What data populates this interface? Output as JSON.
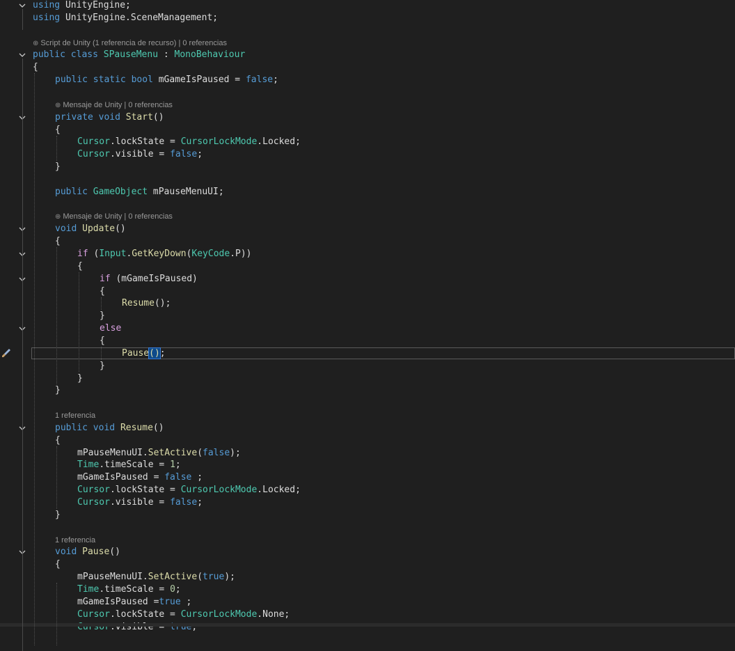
{
  "editor": {
    "language": "C#",
    "colors": {
      "background": "#1f1f1f",
      "keyword": "#569cd6",
      "control_keyword": "#d8a0df",
      "type": "#4ec9b0",
      "method": "#dcdcaa",
      "text": "#dcdcdc",
      "number": "#b5cea8",
      "codelens": "#9a9a9a"
    },
    "lines": [
      {
        "indent": 0,
        "fold": "open",
        "tokens": [
          [
            "kw",
            "using"
          ],
          [
            "plain",
            " UnityEngine;"
          ]
        ]
      },
      {
        "indent": 0,
        "tokens": [
          [
            "kw",
            "using"
          ],
          [
            "plain",
            " UnityEngine.SceneManagement;"
          ]
        ]
      },
      {
        "indent": 0,
        "tokens": []
      },
      {
        "lens": "Script de Unity (1 referencia de recurso) | 0 referencias",
        "lens_icon": "unity-icon",
        "indent": 0
      },
      {
        "indent": 0,
        "fold": "open",
        "tokens": [
          [
            "kw",
            "public"
          ],
          [
            "plain",
            " "
          ],
          [
            "kw",
            "class"
          ],
          [
            "plain",
            " "
          ],
          [
            "type",
            "SPauseMenu"
          ],
          [
            "plain",
            " : "
          ],
          [
            "type",
            "MonoBehaviour"
          ]
        ]
      },
      {
        "indent": 0,
        "tokens": [
          [
            "plain",
            "{"
          ]
        ]
      },
      {
        "indent": 1,
        "tokens": [
          [
            "kw",
            "public"
          ],
          [
            "plain",
            " "
          ],
          [
            "kw",
            "static"
          ],
          [
            "plain",
            " "
          ],
          [
            "kw",
            "bool"
          ],
          [
            "plain",
            " mGameIsPaused = "
          ],
          [
            "kw",
            "false"
          ],
          [
            "plain",
            ";"
          ]
        ]
      },
      {
        "indent": 0,
        "tokens": []
      },
      {
        "lens": "Mensaje de Unity | 0 referencias",
        "lens_icon": "unity-icon",
        "indent": 1
      },
      {
        "indent": 1,
        "fold": "open",
        "tokens": [
          [
            "kw",
            "private"
          ],
          [
            "plain",
            " "
          ],
          [
            "kw",
            "void"
          ],
          [
            "plain",
            " "
          ],
          [
            "fn",
            "Start"
          ],
          [
            "plain",
            "()"
          ]
        ]
      },
      {
        "indent": 1,
        "tokens": [
          [
            "plain",
            "{"
          ]
        ]
      },
      {
        "indent": 2,
        "tokens": [
          [
            "type",
            "Cursor"
          ],
          [
            "plain",
            ".lockState = "
          ],
          [
            "type",
            "CursorLockMode"
          ],
          [
            "plain",
            ".Locked;"
          ]
        ]
      },
      {
        "indent": 2,
        "tokens": [
          [
            "type",
            "Cursor"
          ],
          [
            "plain",
            ".visible = "
          ],
          [
            "kw",
            "false"
          ],
          [
            "plain",
            ";"
          ]
        ]
      },
      {
        "indent": 1,
        "tokens": [
          [
            "plain",
            "}"
          ]
        ]
      },
      {
        "indent": 0,
        "tokens": []
      },
      {
        "indent": 1,
        "tokens": [
          [
            "kw",
            "public"
          ],
          [
            "plain",
            " "
          ],
          [
            "type",
            "GameObject"
          ],
          [
            "plain",
            " mPauseMenuUI;"
          ]
        ]
      },
      {
        "indent": 0,
        "tokens": []
      },
      {
        "lens": "Mensaje de Unity | 0 referencias",
        "lens_icon": "unity-icon",
        "indent": 1
      },
      {
        "indent": 1,
        "fold": "open",
        "tokens": [
          [
            "kw",
            "void"
          ],
          [
            "plain",
            " "
          ],
          [
            "fn",
            "Update"
          ],
          [
            "plain",
            "()"
          ]
        ]
      },
      {
        "indent": 1,
        "tokens": [
          [
            "plain",
            "{"
          ]
        ]
      },
      {
        "indent": 2,
        "fold": "open",
        "tokens": [
          [
            "kw2",
            "if"
          ],
          [
            "plain",
            " ("
          ],
          [
            "type",
            "Input"
          ],
          [
            "plain",
            "."
          ],
          [
            "fn",
            "GetKeyDown"
          ],
          [
            "plain",
            "("
          ],
          [
            "type",
            "KeyCode"
          ],
          [
            "plain",
            ".P))"
          ]
        ]
      },
      {
        "indent": 2,
        "tokens": [
          [
            "plain",
            "{"
          ]
        ]
      },
      {
        "indent": 3,
        "fold": "open",
        "tokens": [
          [
            "kw2",
            "if"
          ],
          [
            "plain",
            " (mGameIsPaused)"
          ]
        ]
      },
      {
        "indent": 3,
        "tokens": [
          [
            "plain",
            "{"
          ]
        ]
      },
      {
        "indent": 4,
        "tokens": [
          [
            "fn",
            "Resume"
          ],
          [
            "plain",
            "();"
          ]
        ]
      },
      {
        "indent": 3,
        "tokens": [
          [
            "plain",
            "}"
          ]
        ]
      },
      {
        "indent": 3,
        "fold": "open",
        "tokens": [
          [
            "kw2",
            "else"
          ]
        ]
      },
      {
        "indent": 3,
        "tokens": [
          [
            "plain",
            "{"
          ]
        ]
      },
      {
        "indent": 4,
        "current": true,
        "tokens": [
          [
            "fn",
            "Pause"
          ],
          [
            "brk",
            "()"
          ],
          [
            "plain",
            ";"
          ]
        ]
      },
      {
        "indent": 3,
        "tokens": [
          [
            "plain",
            "}"
          ]
        ]
      },
      {
        "indent": 2,
        "tokens": [
          [
            "plain",
            "}"
          ]
        ]
      },
      {
        "indent": 1,
        "tokens": [
          [
            "plain",
            "}"
          ]
        ]
      },
      {
        "indent": 0,
        "tokens": []
      },
      {
        "lens": "1 referencia",
        "indent": 1
      },
      {
        "indent": 1,
        "fold": "open",
        "tokens": [
          [
            "kw",
            "public"
          ],
          [
            "plain",
            " "
          ],
          [
            "kw",
            "void"
          ],
          [
            "plain",
            " "
          ],
          [
            "fn",
            "Resume"
          ],
          [
            "plain",
            "()"
          ]
        ]
      },
      {
        "indent": 1,
        "tokens": [
          [
            "plain",
            "{"
          ]
        ]
      },
      {
        "indent": 2,
        "tokens": [
          [
            "plain",
            "mPauseMenuUI."
          ],
          [
            "fn",
            "SetActive"
          ],
          [
            "plain",
            "("
          ],
          [
            "kw",
            "false"
          ],
          [
            "plain",
            ");"
          ]
        ]
      },
      {
        "indent": 2,
        "tokens": [
          [
            "type",
            "Time"
          ],
          [
            "plain",
            ".timeScale = "
          ],
          [
            "num",
            "1"
          ],
          [
            "plain",
            ";"
          ]
        ]
      },
      {
        "indent": 2,
        "tokens": [
          [
            "plain",
            "mGameIsPaused = "
          ],
          [
            "kw",
            "false"
          ],
          [
            "plain",
            " ;"
          ]
        ]
      },
      {
        "indent": 2,
        "tokens": [
          [
            "type",
            "Cursor"
          ],
          [
            "plain",
            ".lockState = "
          ],
          [
            "type",
            "CursorLockMode"
          ],
          [
            "plain",
            ".Locked;"
          ]
        ]
      },
      {
        "indent": 2,
        "tokens": [
          [
            "type",
            "Cursor"
          ],
          [
            "plain",
            ".visible = "
          ],
          [
            "kw",
            "false"
          ],
          [
            "plain",
            ";"
          ]
        ]
      },
      {
        "indent": 1,
        "tokens": [
          [
            "plain",
            "}"
          ]
        ]
      },
      {
        "indent": 0,
        "tokens": []
      },
      {
        "lens": "1 referencia",
        "indent": 1
      },
      {
        "indent": 1,
        "fold": "open",
        "tokens": [
          [
            "kw",
            "void"
          ],
          [
            "plain",
            " "
          ],
          [
            "fn",
            "Pause"
          ],
          [
            "plain",
            "()"
          ]
        ]
      },
      {
        "indent": 1,
        "tokens": [
          [
            "plain",
            "{"
          ]
        ]
      },
      {
        "indent": 2,
        "tokens": [
          [
            "plain",
            "mPauseMenuUI."
          ],
          [
            "fn",
            "SetActive"
          ],
          [
            "plain",
            "("
          ],
          [
            "kw",
            "true"
          ],
          [
            "plain",
            ");"
          ]
        ]
      },
      {
        "indent": 2,
        "tokens": [
          [
            "type",
            "Time"
          ],
          [
            "plain",
            ".timeScale = "
          ],
          [
            "num",
            "0"
          ],
          [
            "plain",
            ";"
          ]
        ]
      },
      {
        "indent": 2,
        "tokens": [
          [
            "plain",
            "mGameIsPaused ="
          ],
          [
            "kw",
            "true"
          ],
          [
            "plain",
            " ;"
          ]
        ]
      },
      {
        "indent": 2,
        "tokens": [
          [
            "type",
            "Cursor"
          ],
          [
            "plain",
            ".lockState = "
          ],
          [
            "type",
            "CursorLockMode"
          ],
          [
            "plain",
            ".None;"
          ]
        ]
      },
      {
        "indent": 2,
        "tokens": [
          [
            "type",
            "Cursor"
          ],
          [
            "plain",
            ".visible = "
          ],
          [
            "kw",
            "true"
          ],
          [
            "plain",
            ";"
          ]
        ]
      }
    ]
  }
}
